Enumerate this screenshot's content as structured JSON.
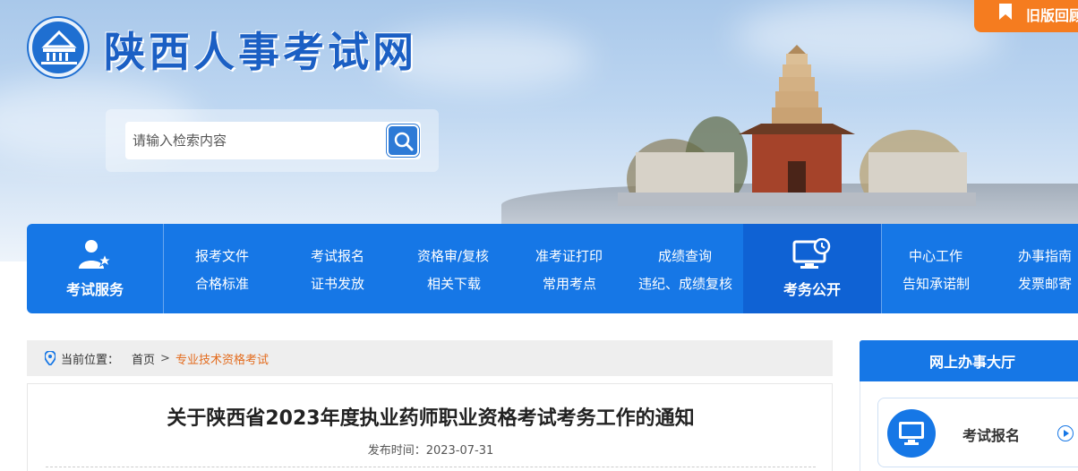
{
  "header": {
    "site_title": "陕西人事考试网",
    "old_version_label": "旧版回顾",
    "search_placeholder": "请输入检索内容"
  },
  "nav": {
    "service_label": "考试服务",
    "links_row1": [
      "报考文件",
      "考试报名",
      "资格审/复核",
      "准考证打印",
      "成绩查询"
    ],
    "links_row2": [
      "合格标准",
      "证书发放",
      "相关下载",
      "常用考点",
      "违纪、成绩复核"
    ],
    "public_label": "考务公开",
    "links_row1_right": [
      "中心工作",
      "办事指南"
    ],
    "links_row2_right": [
      "告知承诺制",
      "发票邮寄"
    ]
  },
  "breadcrumb": {
    "label": "当前位置：",
    "home": "首页",
    "separator": ">",
    "current": "专业技术资格考试"
  },
  "article": {
    "title": "关于陕西省2023年度执业药师职业资格考试考务工作的通知",
    "date_label": "发布时间：",
    "date_value": "2023-07-31"
  },
  "sidebar": {
    "heading": "网上办事大厅",
    "card_label": "考试报名"
  },
  "colors": {
    "primary_blue": "#1677e6",
    "accent_orange": "#f57c1f",
    "breadcrumb_current": "#e36b1d"
  },
  "icons": [
    "emblem-icon",
    "bookmark-icon",
    "search-icon",
    "user-star-icon",
    "monitor-clock-icon",
    "location-pin-icon",
    "monitor-icon",
    "arrow-right-circle-icon"
  ]
}
